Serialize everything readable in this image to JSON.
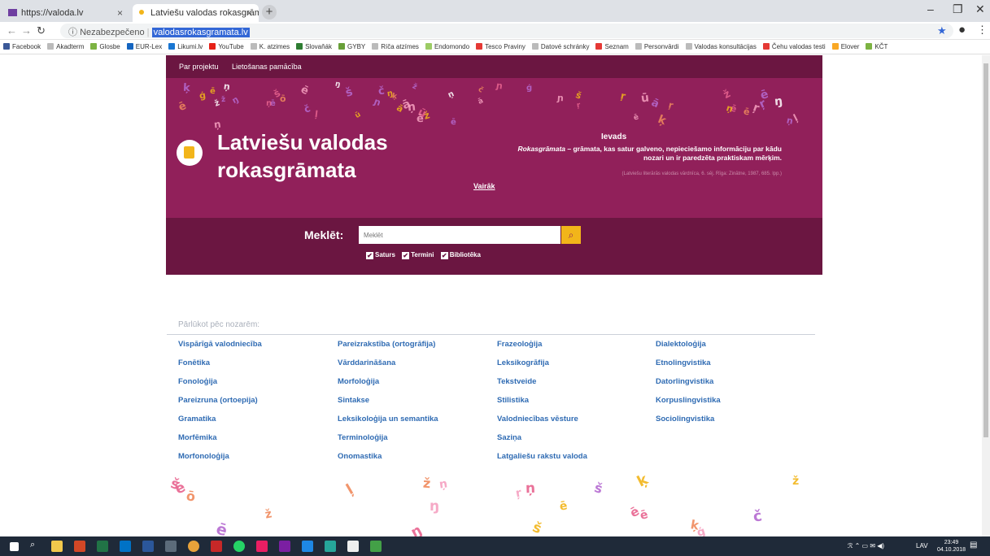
{
  "browser": {
    "tabs": [
      {
        "title": "https://valoda.lv",
        "active": false
      },
      {
        "title": "Latviešu valodas rokasgrāmata",
        "active": true
      }
    ],
    "new_tab": "+",
    "address": {
      "security": "Nezabezpečeno",
      "url": "valodasrokasgramata.lv"
    },
    "bookmarks": [
      "Facebook",
      "Akadterm",
      "Glosbe",
      "EUR-Lex",
      "Likumi.lv",
      "YouTube",
      "K. atzimes",
      "Slovaňák",
      "GYBY",
      "Ríča atzímes",
      "Endomondo",
      "Tesco Praviny",
      "Datové schránky",
      "Seznam",
      "Personvārdi",
      "Valodas konsultācijas",
      "Čehu valodas testi",
      "Elover",
      "KČT"
    ],
    "bookmark_colors": [
      "#3b5998",
      "#bbbbbb",
      "#7cb342",
      "#1565c0",
      "#1976d2",
      "#e62117",
      "#bbbbbb",
      "#2e7d32",
      "#689f38",
      "#bbbbbb",
      "#9ccc65",
      "#e53935",
      "#bbbbbb",
      "#e53935",
      "#bbbbbb",
      "#bbbbbb",
      "#e53935",
      "#f9a825",
      "#7cb342"
    ]
  },
  "site": {
    "nav": [
      "Par projektu",
      "Lietošanas pamācība"
    ],
    "title_line1": "Latviešu valodas",
    "title_line2": "rokasgrāmata",
    "intro": {
      "heading": "Ievads",
      "text_em": "Rokasgrāmata",
      "text": " – grāmata, kas satur galveno, nepieciešamo informāciju par kādu nozari un ir paredzēta praktiskam mērķim.",
      "source": "(Latviešu literārās valodas vārdnīca, 6. sēj. Rīga: Zinātne, 1987, 685. lpp.)",
      "more": "Vairāk"
    },
    "search": {
      "label": "Meklēt:",
      "placeholder": "Meklēt",
      "button_icon": "search-icon",
      "checks": [
        {
          "label": "Saturs",
          "checked": true
        },
        {
          "label": "Termini",
          "checked": true
        },
        {
          "label": "Bibliotēka",
          "checked": true
        }
      ]
    },
    "browse": {
      "title": "Pārlūkot pēc nozarēm:",
      "columns": [
        [
          "Vispārīgā valodniecība",
          "Fonētika",
          "Fonoloģija",
          "Pareizruna (ortoepija)",
          "Gramatika",
          "Morfēmika",
          "Morfonoloģija"
        ],
        [
          "Pareizrakstība (ortogrāfija)",
          "Vārddarināšana",
          "Morfoloģija",
          "Sintakse",
          "Leksikoloģija un semantika",
          "Terminoloģija",
          "Onomastika"
        ],
        [
          "Frazeoloģija",
          "Leksikogrāfija",
          "Tekstveide",
          "Stilistika",
          "Valodniecības vēsture",
          "Saziņa",
          "Latgaliešu rakstu valoda"
        ],
        [
          "Dialektoloģija",
          "Etnolingvistika",
          "Datorlingvistika",
          "Korpuslingvistika",
          "Sociolingvistika"
        ]
      ]
    },
    "colors": {
      "brand": "#91205a",
      "brand_dark": "#6b1641",
      "accent": "#f2b51a",
      "link": "#2f6bb3"
    }
  },
  "taskbar": {
    "tray": {
      "lang": "LAV",
      "time": "23:49",
      "date": "04.10.2018"
    }
  }
}
